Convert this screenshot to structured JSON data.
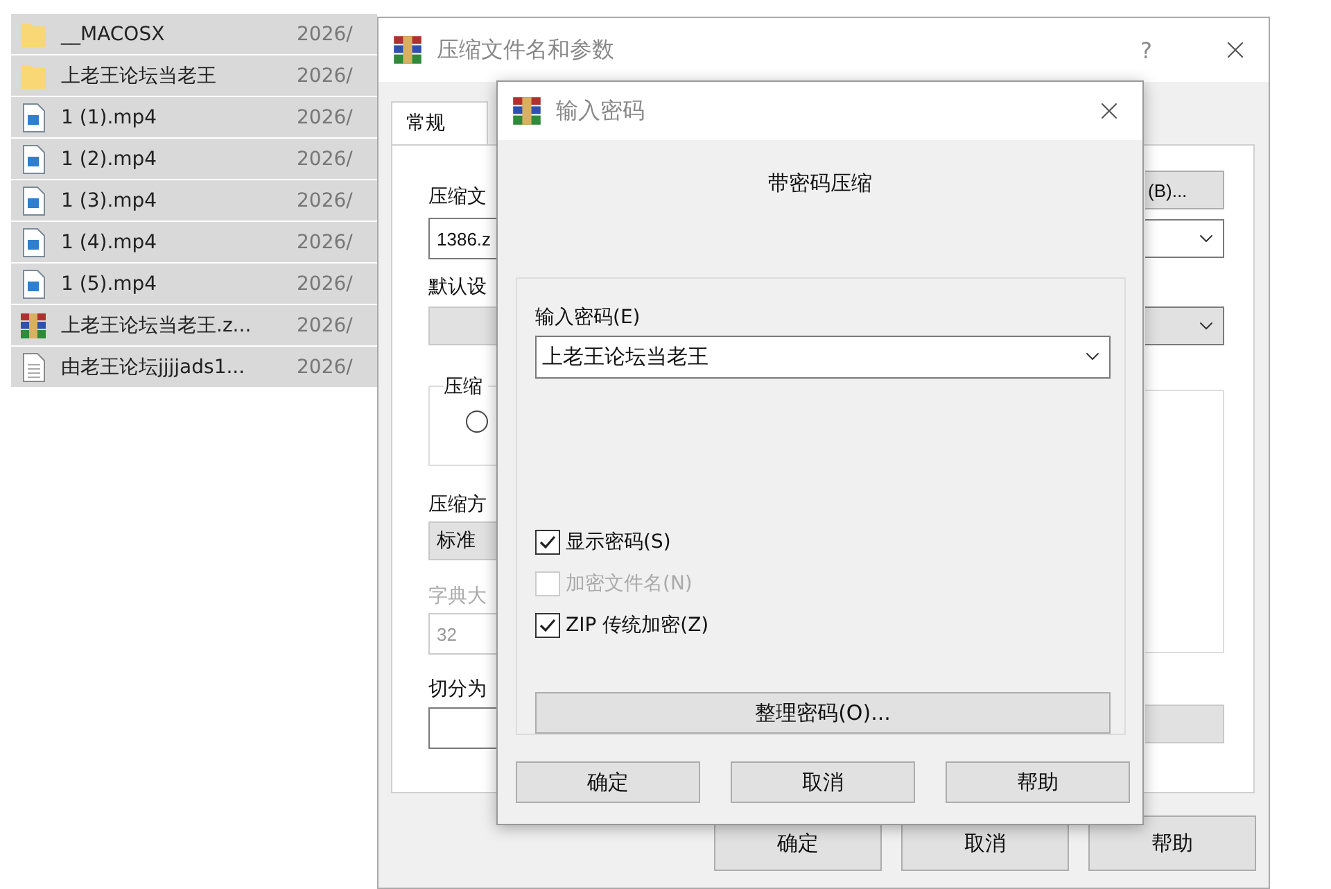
{
  "file_list": {
    "rows": [
      {
        "kind": "folder",
        "name": "__MACOSX",
        "date": "2026/",
        "selected": true
      },
      {
        "kind": "folder",
        "name": "上老王论坛当老王",
        "date": "2026/",
        "selected": true
      },
      {
        "kind": "video",
        "name": "1 (1).mp4",
        "date": "2026/",
        "selected": true
      },
      {
        "kind": "video",
        "name": "1 (2).mp4",
        "date": "2026/",
        "selected": true
      },
      {
        "kind": "video",
        "name": "1 (3).mp4",
        "date": "2026/",
        "selected": true
      },
      {
        "kind": "video",
        "name": "1 (4).mp4",
        "date": "2026/",
        "selected": true
      },
      {
        "kind": "video",
        "name": "1 (5).mp4",
        "date": "2026/",
        "selected": true
      },
      {
        "kind": "archive",
        "name": "上老王论坛当老王.z...",
        "date": "2026/",
        "selected": true
      },
      {
        "kind": "text",
        "name": "由老王论坛jjjjads1...",
        "date": "2026/",
        "selected": true
      }
    ]
  },
  "archive_dialog": {
    "title": "压缩文件名和参数",
    "help": "?",
    "tabs": [
      {
        "label": "常规",
        "selected": true
      }
    ],
    "archive_name": {
      "label": "压缩文",
      "value": "1386.z"
    },
    "browse_button": "(B)...",
    "profile_label": "默认设",
    "group": {
      "label": "压缩",
      "radio_selected": false
    },
    "method": {
      "label": "压缩方",
      "value": "标准"
    },
    "dictionary": {
      "label": "字典大",
      "value": "32",
      "disabled": true
    },
    "split_label": "切分为",
    "buttons": [
      "确定",
      "取消",
      "帮助"
    ]
  },
  "password_dialog": {
    "title": "输入密码",
    "heading": "带密码压缩",
    "password": {
      "label": "输入密码(E)",
      "value": "上老王论坛当老王"
    },
    "options": [
      {
        "label": "显示密码(S)",
        "checked": true,
        "disabled": false
      },
      {
        "label": "加密文件名(N)",
        "checked": false,
        "disabled": true
      },
      {
        "label": "ZIP 传统加密(Z)",
        "checked": true,
        "disabled": false
      }
    ],
    "organize_button": "整理密码(O)...",
    "buttons": [
      "确定",
      "取消",
      "帮助"
    ]
  }
}
